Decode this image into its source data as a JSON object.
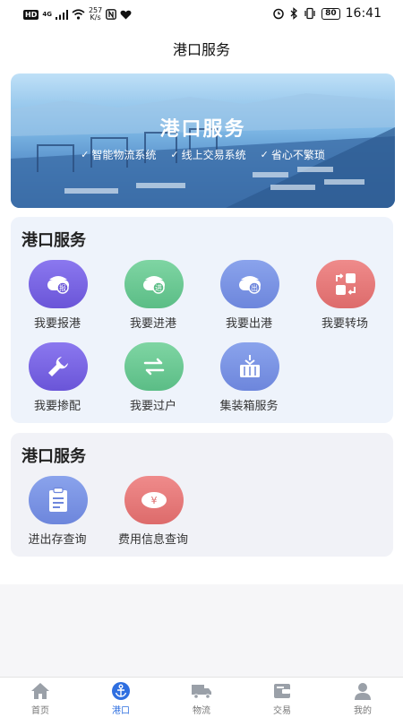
{
  "status_bar": {
    "hd": "HD",
    "network": "4G",
    "speed_value": "257",
    "speed_unit": "K/s",
    "battery": "80",
    "time": "16:41"
  },
  "header": {
    "title": "港口服务"
  },
  "banner": {
    "title": "港口服务",
    "tags": [
      "智能物流系统",
      "线上交易系统",
      "省心不繁琐"
    ]
  },
  "section1": {
    "title": "港口服务",
    "items": [
      {
        "label": "我要报港",
        "icon": "ship-report-icon",
        "glyph": "报",
        "color": "#7b66e6"
      },
      {
        "label": "我要进港",
        "icon": "ship-enter-icon",
        "glyph": "进",
        "color": "#6cc995"
      },
      {
        "label": "我要出港",
        "icon": "ship-exit-icon",
        "glyph": "出",
        "color": "#7c95e4"
      },
      {
        "label": "我要转场",
        "icon": "transfer-icon",
        "glyph": "",
        "color": "#e57b7b"
      },
      {
        "label": "我要掺配",
        "icon": "wrench-icon",
        "glyph": "",
        "color": "#7b66e6"
      },
      {
        "label": "我要过户",
        "icon": "swap-icon",
        "glyph": "",
        "color": "#6cc995"
      },
      {
        "label": "集装箱服务",
        "icon": "container-icon",
        "glyph": "",
        "color": "#7c95e4"
      }
    ]
  },
  "section2": {
    "title": "港口服务",
    "items": [
      {
        "label": "进出存查询",
        "icon": "clipboard-icon",
        "glyph": ""
      },
      {
        "label": "费用信息查询",
        "icon": "fee-icon",
        "glyph": "¥"
      }
    ]
  },
  "tabbar": {
    "items": [
      {
        "label": "首页",
        "icon": "home-icon",
        "active": false
      },
      {
        "label": "港口",
        "icon": "anchor-icon",
        "active": true
      },
      {
        "label": "物流",
        "icon": "truck-icon",
        "active": false
      },
      {
        "label": "交易",
        "icon": "wallet-icon",
        "active": false
      },
      {
        "label": "我的",
        "icon": "user-icon",
        "active": false
      }
    ]
  },
  "colors": {
    "accent": "#2f6fe0",
    "tab_inactive": "#9aa0a8"
  }
}
